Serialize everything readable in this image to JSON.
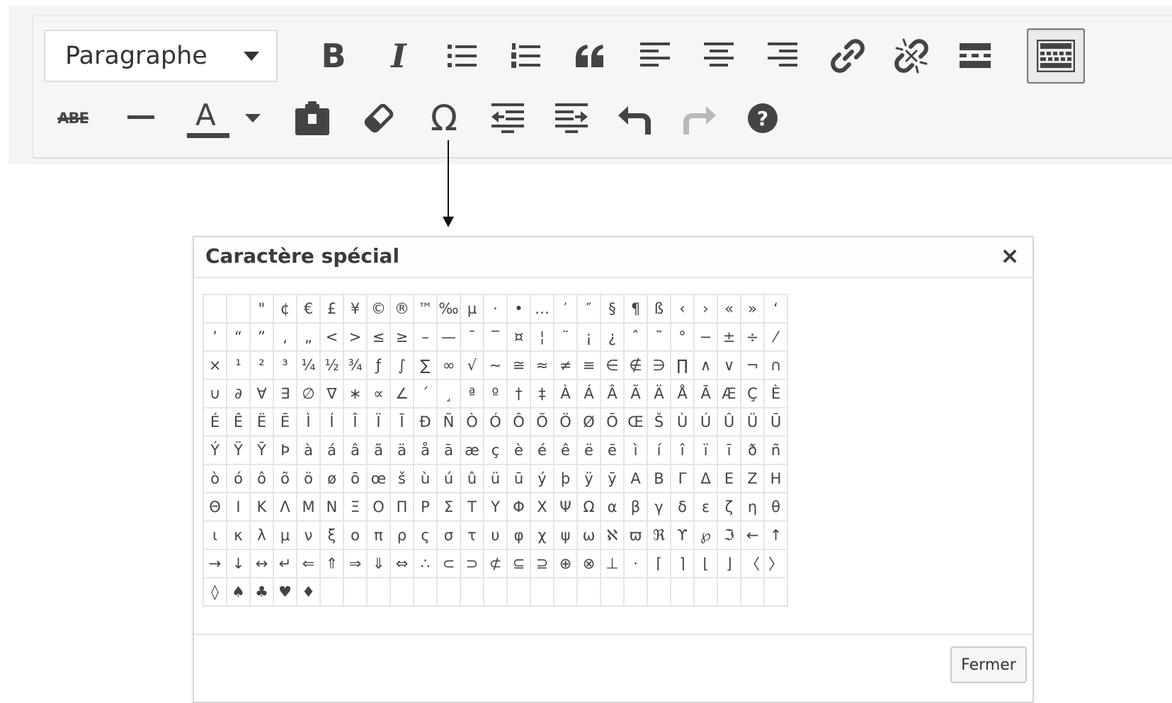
{
  "toolbar": {
    "format_select": {
      "value": "Paragraphe"
    },
    "row1": [
      "bold-button",
      "italic-button",
      "bullet-list-button",
      "numbered-list-button",
      "blockquote-button",
      "align-left-button",
      "align-center-button",
      "align-right-button",
      "insert-link-button",
      "remove-link-button",
      "read-more-button",
      "toolbar-toggle-button"
    ],
    "row2": [
      "strikethrough-button",
      "horizontal-line-button",
      "text-color-button",
      "paste-as-text-button",
      "clear-formatting-button",
      "special-character-button",
      "decrease-indent-button",
      "increase-indent-button",
      "undo-button",
      "redo-button",
      "help-button"
    ],
    "icons": {
      "strikethrough_text": "ABE",
      "text_color_letter": "A",
      "bold_letter": "B",
      "italic_letter": "I",
      "omega": "Ω",
      "help": "?"
    },
    "colors": {
      "icon": "#444444",
      "disabled": "#b5b5b5",
      "active_border": "#777777"
    }
  },
  "dialog": {
    "title": "Caractère spécial",
    "close_icon": "×",
    "close_button": "Fermer",
    "characters": [
      [
        " ",
        " ",
        "\"",
        "¢",
        "€",
        "£",
        "¥",
        "©",
        "®",
        "™",
        "‰",
        "µ",
        "·",
        "•",
        "…",
        "′",
        "″",
        "§",
        "¶",
        "ß",
        "‹",
        "›",
        "«",
        "»",
        "‘"
      ],
      [
        "’",
        "“",
        "”",
        "‚",
        "„",
        "<",
        ">",
        "≤",
        "≥",
        "–",
        "—",
        "¯",
        "‾",
        "¤",
        "¦",
        "¨",
        "¡",
        "¿",
        "ˆ",
        "˜",
        "°",
        "−",
        "±",
        "÷",
        "⁄"
      ],
      [
        "×",
        "¹",
        "²",
        "³",
        "¼",
        "½",
        "¾",
        "ƒ",
        "∫",
        "∑",
        "∞",
        "√",
        "∼",
        "≅",
        "≈",
        "≠",
        "≡",
        "∈",
        "∉",
        "∋",
        "∏",
        "∧",
        "∨",
        "¬",
        "∩"
      ],
      [
        "∪",
        "∂",
        "∀",
        "∃",
        "∅",
        "∇",
        "∗",
        "∝",
        "∠",
        "´",
        "¸",
        "ª",
        "º",
        "†",
        "‡",
        "À",
        "Á",
        "Â",
        "Ã",
        "Ä",
        "Å",
        "Ā",
        "Æ",
        "Ç",
        "È"
      ],
      [
        "É",
        "Ê",
        "Ë",
        "Ē",
        "Ì",
        "Í",
        "Î",
        "Ï",
        "Ī",
        "Ð",
        "Ñ",
        "Ò",
        "Ó",
        "Ô",
        "Õ",
        "Ö",
        "Ø",
        "Ō",
        "Œ",
        "Š",
        "Ù",
        "Ú",
        "Û",
        "Ü",
        "Ū"
      ],
      [
        "Ý",
        "Ÿ",
        "Ȳ",
        "Þ",
        "à",
        "á",
        "â",
        "ã",
        "ä",
        "å",
        "ā",
        "æ",
        "ç",
        "è",
        "é",
        "ê",
        "ë",
        "ē",
        "ì",
        "í",
        "î",
        "ï",
        "ī",
        "ð",
        "ñ"
      ],
      [
        "ò",
        "ó",
        "ô",
        "õ",
        "ö",
        "ø",
        "ō",
        "œ",
        "š",
        "ù",
        "ú",
        "û",
        "ü",
        "ū",
        "ý",
        "þ",
        "ÿ",
        "ȳ",
        "Α",
        "Β",
        "Γ",
        "Δ",
        "Ε",
        "Ζ",
        "Η"
      ],
      [
        "Θ",
        "Ι",
        "Κ",
        "Λ",
        "Μ",
        "Ν",
        "Ξ",
        "Ο",
        "Π",
        "Ρ",
        "Σ",
        "Τ",
        "Υ",
        "Φ",
        "Χ",
        "Ψ",
        "Ω",
        "α",
        "β",
        "γ",
        "δ",
        "ε",
        "ζ",
        "η",
        "θ"
      ],
      [
        "ι",
        "κ",
        "λ",
        "μ",
        "ν",
        "ξ",
        "ο",
        "π",
        "ρ",
        "ς",
        "σ",
        "τ",
        "υ",
        "φ",
        "χ",
        "ψ",
        "ω",
        "ℵ",
        "ϖ",
        "ℜ",
        "ϒ",
        "℘",
        "ℑ",
        "←",
        "↑"
      ],
      [
        "→",
        "↓",
        "↔",
        "↵",
        "⇐",
        "⇑",
        "⇒",
        "⇓",
        "⇔",
        "∴",
        "⊂",
        "⊃",
        "⊄",
        "⊆",
        "⊇",
        "⊕",
        "⊗",
        "⊥",
        "⋅",
        "⌈",
        "⌉",
        "⌊",
        "⌋",
        "〈",
        "〉"
      ],
      [
        "◊",
        "♠",
        "♣",
        "♥",
        "♦",
        "",
        "",
        "",
        "",
        "",
        "",
        "",
        "",
        "",
        "",
        "",
        "",
        "",
        "",
        "",
        "",
        "",
        "",
        "",
        ""
      ]
    ]
  }
}
